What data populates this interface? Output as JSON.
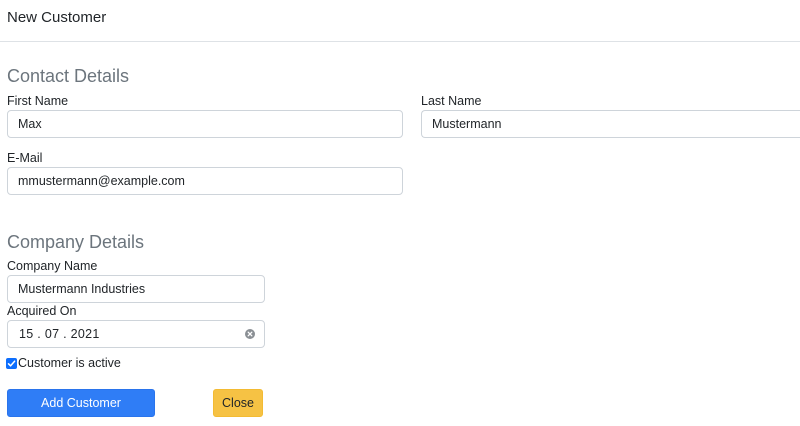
{
  "dialog": {
    "title": "New Customer"
  },
  "contact_details": {
    "heading": "Contact Details",
    "first_name": {
      "label": "First Name",
      "value": "Max"
    },
    "last_name": {
      "label": "Last Name",
      "value": "Mustermann"
    },
    "email": {
      "label": "E-Mail",
      "value": "mmustermann@example.com"
    }
  },
  "company_details": {
    "heading": "Company Details",
    "company_name": {
      "label": "Company Name",
      "value": "Mustermann Industries"
    },
    "acquired_on": {
      "label": "Acquired On",
      "value": "15 . 07 . 2021",
      "clear_icon": "clear-circle-icon"
    },
    "active": {
      "label": "Customer is active",
      "checked": true
    }
  },
  "actions": {
    "submit_label": "Add Customer",
    "close_label": "Close"
  },
  "colors": {
    "primary": "#2f7df6",
    "warning": "#f6c244",
    "heading_muted": "#6c757d",
    "checkbox": "#0d6efd"
  }
}
